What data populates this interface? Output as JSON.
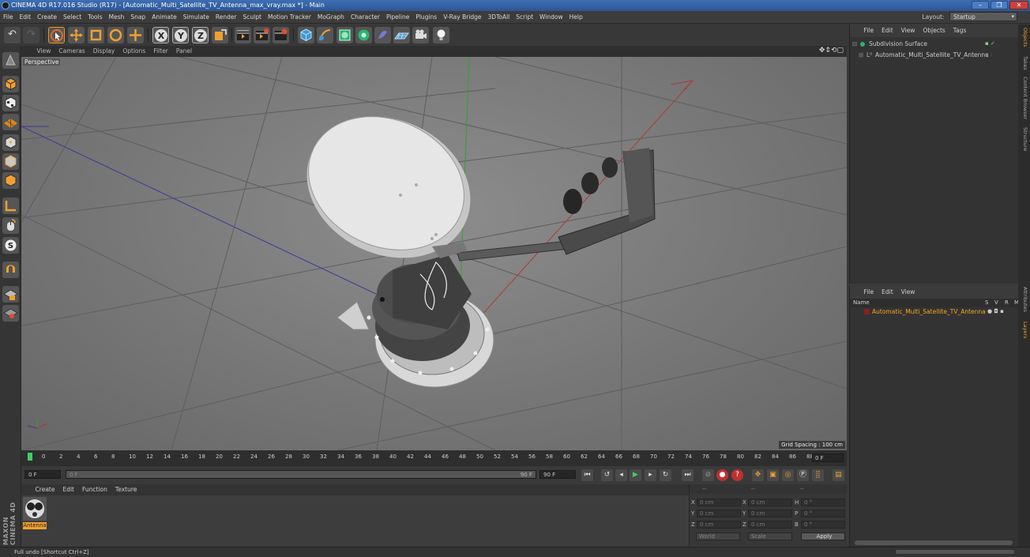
{
  "window": {
    "title": "CINEMA 4D R17.016 Studio (R17) - [Automatic_Multi_Satellite_TV_Antenna_max_vray.max *] - Main",
    "buttons": [
      "–",
      "❐",
      "✕"
    ]
  },
  "menu": {
    "items": [
      "File",
      "Edit",
      "Create",
      "Select",
      "Tools",
      "Mesh",
      "Snap",
      "Animate",
      "Simulate",
      "Render",
      "Sculpt",
      "Motion Tracker",
      "MoGraph",
      "Character",
      "Pipeline",
      "Plugins",
      "V-Ray Bridge",
      "3DToAll",
      "Script",
      "Window",
      "Help"
    ],
    "layout_label": "Layout:",
    "layout_value": "Startup"
  },
  "toolbar": {
    "axis_x": "X",
    "axis_y": "Y",
    "axis_z": "Z"
  },
  "viewport": {
    "menu": [
      "View",
      "Cameras",
      "Display",
      "Options",
      "Filter",
      "Panel"
    ],
    "label": "Perspective",
    "grid_spacing": "Grid Spacing : 100 cm"
  },
  "timeline": {
    "ticks": [
      "0",
      "2",
      "4",
      "6",
      "8",
      "10",
      "12",
      "14",
      "16",
      "18",
      "20",
      "22",
      "24",
      "26",
      "28",
      "30",
      "32",
      "34",
      "36",
      "38",
      "40",
      "42",
      "44",
      "46",
      "48",
      "50",
      "52",
      "54",
      "56",
      "58",
      "60",
      "62",
      "64",
      "66",
      "68",
      "70",
      "72",
      "74",
      "76",
      "78",
      "80",
      "82",
      "84",
      "86",
      "88",
      "90"
    ],
    "end_field": "0 F",
    "current": "0 F",
    "slider_start": "0 F",
    "slider_end": "90 F",
    "max": "90 F"
  },
  "materials": {
    "menu": [
      "Create",
      "Edit",
      "Function",
      "Texture"
    ],
    "items": [
      {
        "name": "Antenna"
      }
    ]
  },
  "coordinates": {
    "header": [
      "--",
      "--",
      "--"
    ],
    "rows": [
      {
        "a": "X",
        "av": "0 cm",
        "b": "X",
        "bv": "0 cm",
        "c": "H",
        "cv": "0 °"
      },
      {
        "a": "Y",
        "av": "0 cm",
        "b": "Y",
        "bv": "0 cm",
        "c": "P",
        "cv": "0 °"
      },
      {
        "a": "Z",
        "av": "0 cm",
        "b": "Z",
        "bv": "0 cm",
        "c": "B",
        "cv": "0 °"
      }
    ],
    "mode1": "World",
    "mode2": "Scale",
    "apply": "Apply"
  },
  "objects": {
    "menu": [
      "File",
      "Edit",
      "View",
      "Objects",
      "Tags"
    ],
    "items": [
      {
        "name": "Subdivision Surface"
      },
      {
        "name": "Automatic_Multi_Satellite_TV_Antenna"
      }
    ]
  },
  "layers": {
    "menu": [
      "File",
      "Edit",
      "View"
    ],
    "columns": [
      "Name",
      "S",
      "V",
      "R",
      "M"
    ],
    "items": [
      {
        "name": "Automatic_Multi_Satellite_TV_Antenna"
      }
    ]
  },
  "right_tabs": [
    "Objects",
    "Takes",
    "Content Browser",
    "Structure",
    "Attributes",
    "Layers"
  ],
  "brand": "MAXON CINEMA 4D",
  "status": "Full undo [Shortcut Ctrl+Z]",
  "colors": {
    "accent": "#f0a030",
    "selected_text": "#f5a623",
    "titlebar": "#2a5596",
    "x_axis": "#b83a3a",
    "y_axis": "#3aa83a",
    "z_axis": "#3a3ab8"
  }
}
